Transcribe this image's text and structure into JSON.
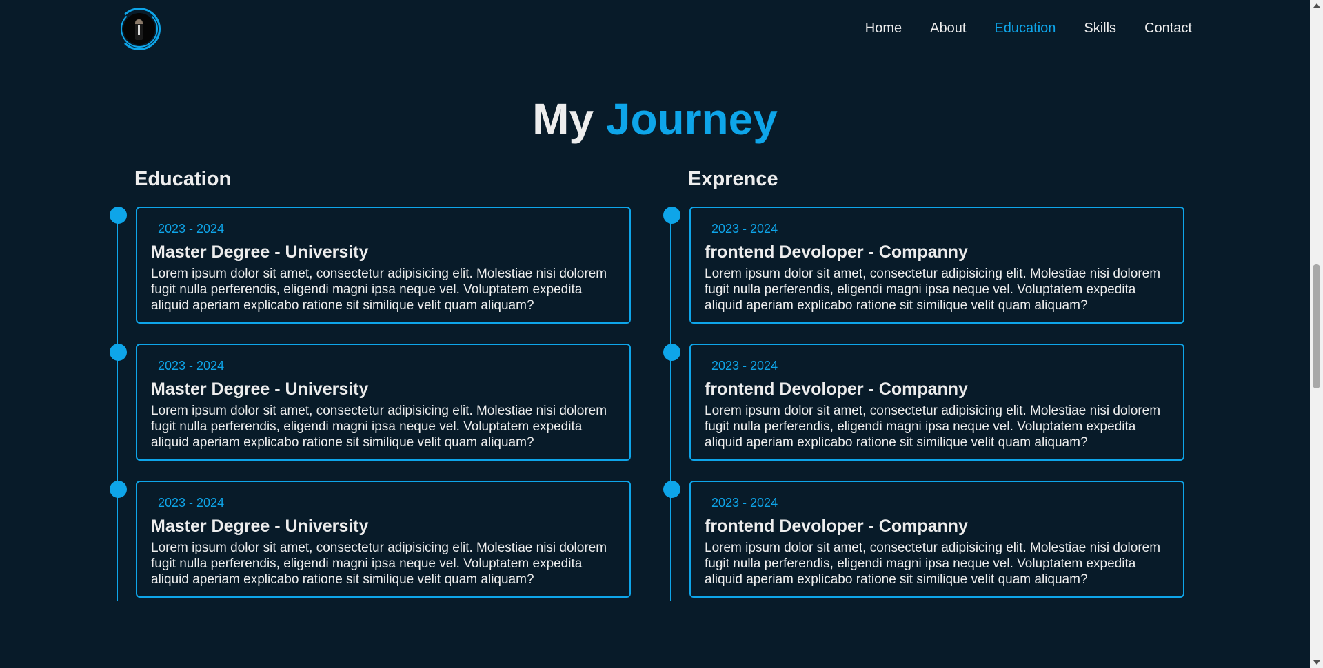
{
  "nav": {
    "items": [
      {
        "label": "Home",
        "active": false
      },
      {
        "label": "About",
        "active": false
      },
      {
        "label": "Education",
        "active": true
      },
      {
        "label": "Skills",
        "active": false
      },
      {
        "label": "Contact",
        "active": false
      }
    ]
  },
  "heading": {
    "plain": "My",
    "accent": "Journey"
  },
  "education": {
    "title": "Education",
    "items": [
      {
        "year": "2023 - 2024",
        "title": "Master Degree - University",
        "description": "Lorem ipsum dolor sit amet, consectetur adipisicing elit. Molestiae nisi dolorem fugit nulla perferendis, eligendi magni ipsa neque vel. Voluptatem expedita aliquid aperiam explicabo ratione sit similique velit quam aliquam?"
      },
      {
        "year": "2023 - 2024",
        "title": "Master Degree - University",
        "description": "Lorem ipsum dolor sit amet, consectetur adipisicing elit. Molestiae nisi dolorem fugit nulla perferendis, eligendi magni ipsa neque vel. Voluptatem expedita aliquid aperiam explicabo ratione sit similique velit quam aliquam?"
      },
      {
        "year": "2023 - 2024",
        "title": "Master Degree - University",
        "description": "Lorem ipsum dolor sit amet, consectetur adipisicing elit. Molestiae nisi dolorem fugit nulla perferendis, eligendi magni ipsa neque vel. Voluptatem expedita aliquid aperiam explicabo ratione sit similique velit quam aliquam?"
      }
    ]
  },
  "experience": {
    "title": "Exprence",
    "items": [
      {
        "year": "2023 - 2024",
        "title": "frontend Devoloper - Companny",
        "description": "Lorem ipsum dolor sit amet, consectetur adipisicing elit. Molestiae nisi dolorem fugit nulla perferendis, eligendi magni ipsa neque vel. Voluptatem expedita aliquid aperiam explicabo ratione sit similique velit quam aliquam?"
      },
      {
        "year": "2023 - 2024",
        "title": "frontend Devoloper - Companny",
        "description": "Lorem ipsum dolor sit amet, consectetur adipisicing elit. Molestiae nisi dolorem fugit nulla perferendis, eligendi magni ipsa neque vel. Voluptatem expedita aliquid aperiam explicabo ratione sit similique velit quam aliquam?"
      },
      {
        "year": "2023 - 2024",
        "title": "frontend Devoloper - Companny",
        "description": "Lorem ipsum dolor sit amet, consectetur adipisicing elit. Molestiae nisi dolorem fugit nulla perferendis, eligendi magni ipsa neque vel. Voluptatem expedita aliquid aperiam explicabo ratione sit similique velit quam aliquam?"
      }
    ]
  },
  "colors": {
    "background": "#081b29",
    "accent": "#0ea5e9",
    "text": "#ededed"
  },
  "icons": {
    "logo": "profile-avatar-logo"
  }
}
